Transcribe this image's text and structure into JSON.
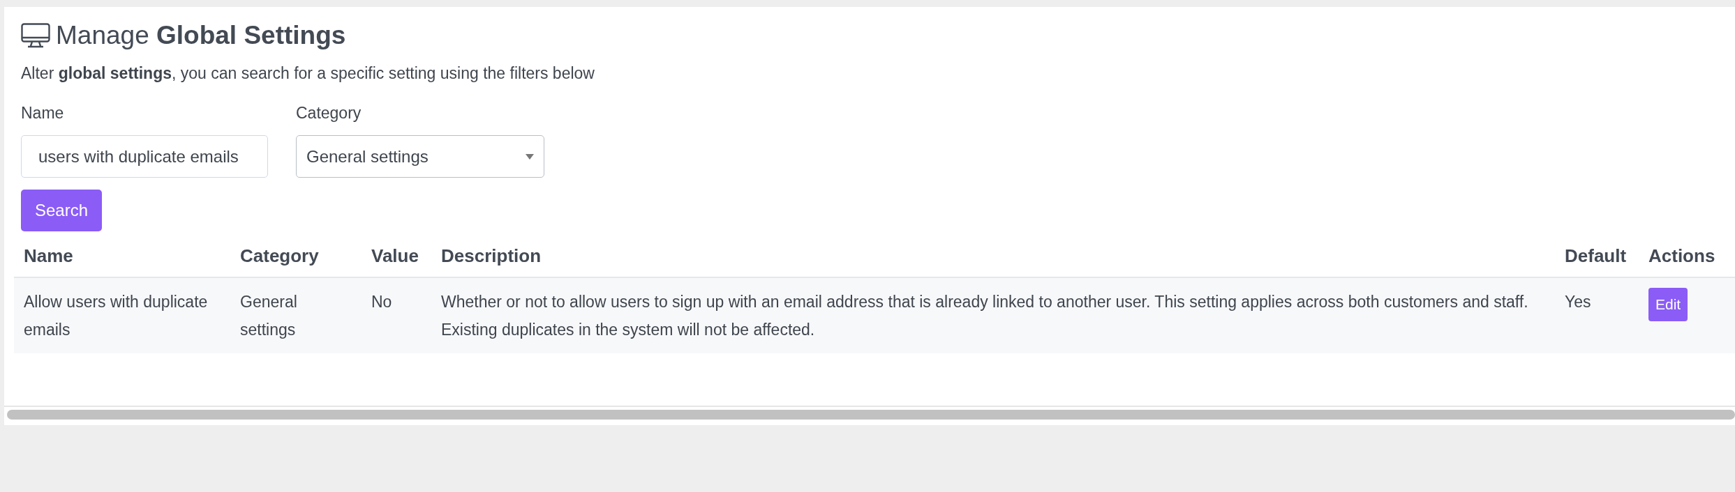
{
  "page": {
    "title_prefix": "Manage ",
    "title_bold": "Global Settings",
    "intro": "Alter **global settings**, you can search for a specific setting using the filters below"
  },
  "filters": {
    "name_label": "Name",
    "name_value": "users with duplicate emails",
    "category_label": "Category",
    "category_value": "General settings",
    "search_button": "Search"
  },
  "table": {
    "columns": [
      "Name",
      "Category",
      "Value",
      "Description",
      "Default",
      "Actions"
    ],
    "rows": [
      {
        "name": "Allow users with duplicate emails",
        "category": "General settings",
        "value": "No",
        "description": "Whether or not to allow users to sign up with an email address that is already linked to another user. This setting applies across both customers and staff. Existing duplicates in the system will not be affected.",
        "default": "Yes",
        "action": "Edit"
      }
    ]
  }
}
